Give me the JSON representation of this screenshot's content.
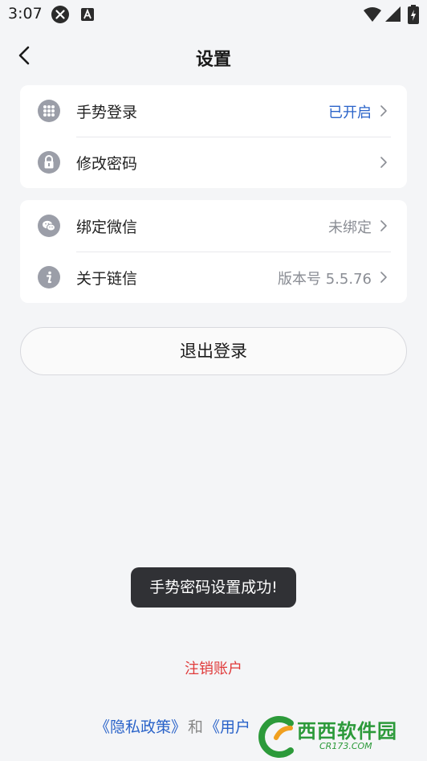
{
  "status_bar": {
    "time": "3:07"
  },
  "nav": {
    "title": "设置"
  },
  "card_1": {
    "rows": [
      {
        "label": "手势登录",
        "value": "已开启",
        "icon": "keypad-dots-icon"
      },
      {
        "label": "修改密码",
        "value": "",
        "icon": "lock-icon"
      }
    ]
  },
  "card_2": {
    "rows": [
      {
        "label": "绑定微信",
        "value": "未绑定",
        "icon": "wechat-icon"
      },
      {
        "label": "关于链信",
        "value": "版本号 5.5.76",
        "icon": "info-icon"
      }
    ]
  },
  "logout": {
    "label": "退出登录"
  },
  "toast": {
    "message": "手势密码设置成功!"
  },
  "delete_account": {
    "label": "注销账户"
  },
  "footer": {
    "privacy_link": "《隐私政策》",
    "and": "和",
    "user_link": "《用户"
  },
  "watermark": {
    "text": "西西软件园",
    "sub": "CR173.COM"
  },
  "colors": {
    "accent": "#2a63c9",
    "danger": "#e03a3a",
    "background": "#f4f5f7"
  }
}
